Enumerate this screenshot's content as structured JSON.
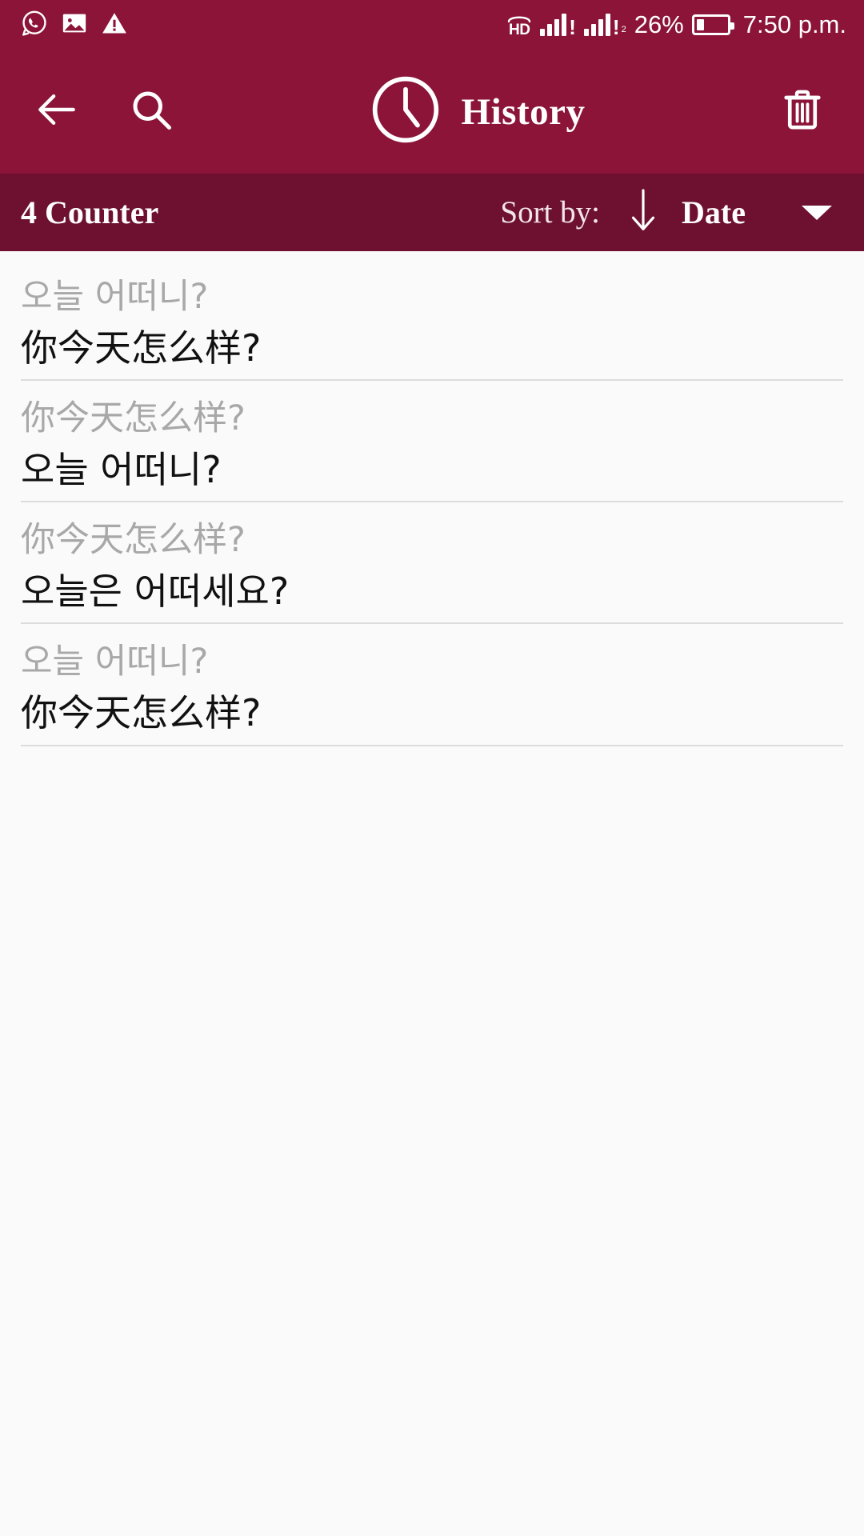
{
  "status_bar": {
    "left_icons": [
      {
        "name": "whatsapp-icon",
        "label": "WhatsApp"
      },
      {
        "name": "image-icon",
        "label": "Screenshot"
      },
      {
        "name": "warning-icon",
        "label": "Warning"
      }
    ],
    "volte_label": "HD",
    "sim1_badge": "!",
    "sim2_badge": "!",
    "sim2_sub": "2",
    "battery_percent": "26%",
    "battery_level": 26,
    "time": "7:50 p.m."
  },
  "app_bar": {
    "back_icon": "arrow-left-icon",
    "search_icon": "search-icon",
    "clock_icon": "clock-icon",
    "title": "History",
    "delete_icon": "trash-icon"
  },
  "sort_bar": {
    "counter": "4 Counter",
    "sort_by_label": "Sort by:",
    "direction_icon": "arrow-down-icon",
    "sort_value": "Date",
    "dropdown_icon": "caret-down-icon"
  },
  "history": {
    "items": [
      {
        "source": "오늘 어떠니?",
        "result": "你今天怎么样?"
      },
      {
        "source": "你今天怎么样?",
        "result": "오늘 어떠니?"
      },
      {
        "source": "你今天怎么样?",
        "result": "오늘은 어떠세요?"
      },
      {
        "source": "오늘 어떠니?",
        "result": "你今天怎么样?"
      }
    ]
  },
  "colors": {
    "app_bar": "#8b1438",
    "sort_bar": "#6e1130",
    "page_background": "#fafafa",
    "source_text": "#a8a8a8",
    "result_text": "#111111",
    "divider": "#dcdcdc"
  }
}
